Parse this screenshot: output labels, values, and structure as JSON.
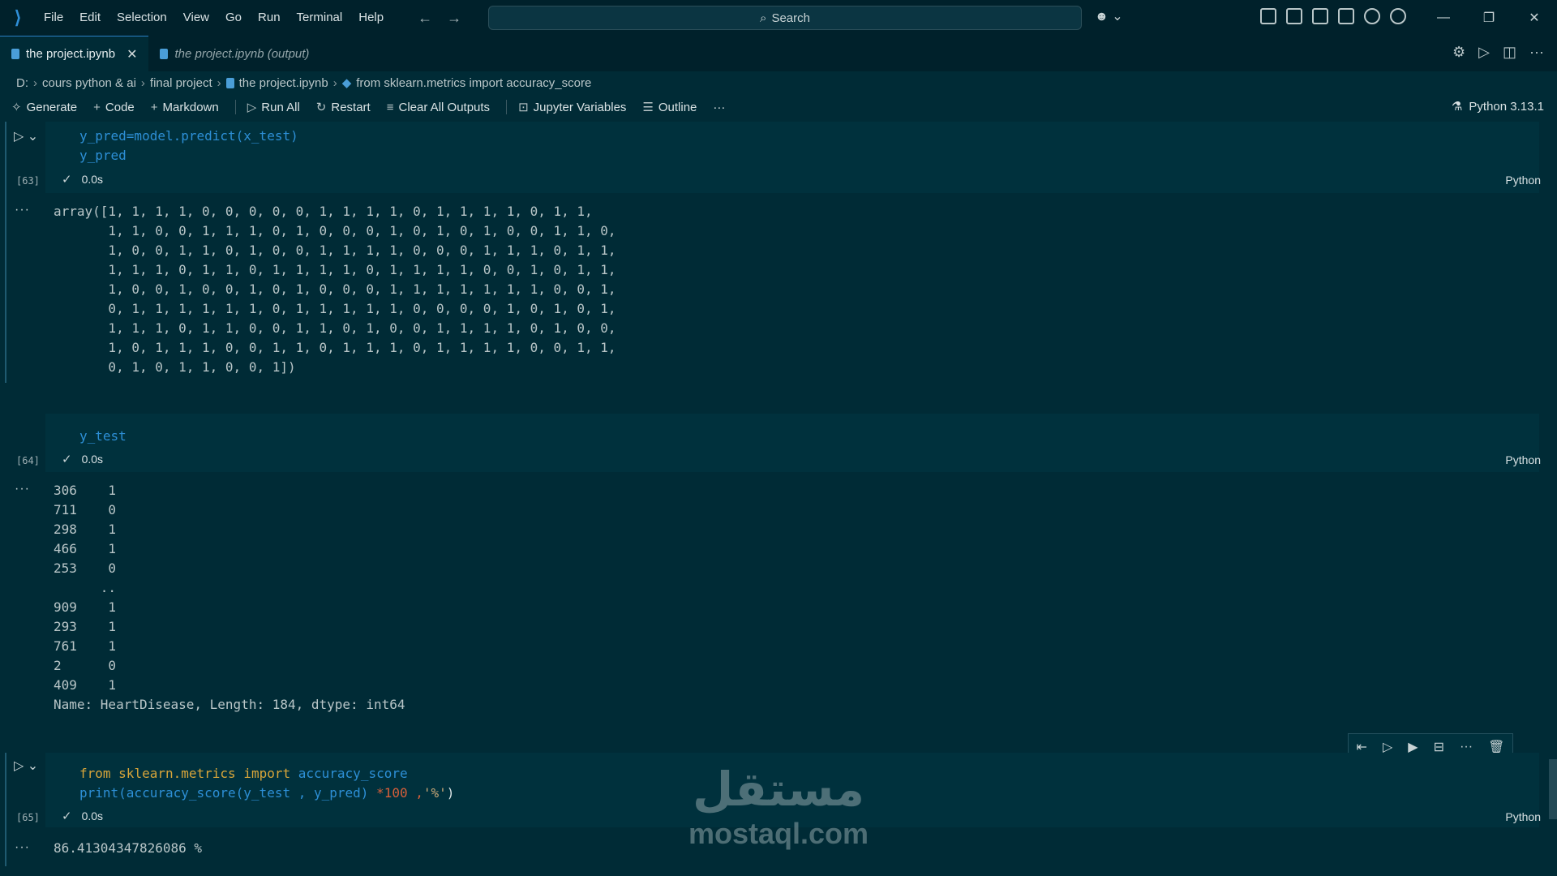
{
  "menu": [
    "File",
    "Edit",
    "Selection",
    "View",
    "Go",
    "Run",
    "Terminal",
    "Help"
  ],
  "search": {
    "label": "Search"
  },
  "tabs": [
    {
      "label": "the project.ipynb",
      "active": true
    },
    {
      "label": "the project.ipynb (output)",
      "active": false
    }
  ],
  "breadcrumb": [
    "D:",
    "cours python & ai",
    "final project",
    "the project.ipynb",
    "from sklearn.metrics import accuracy_score"
  ],
  "toolbar": {
    "generate": "Generate",
    "code": "Code",
    "markdown": "Markdown",
    "run_all": "Run All",
    "restart": "Restart",
    "clear": "Clear All Outputs",
    "variables": "Jupyter Variables",
    "outline": "Outline",
    "more": "···",
    "kernel": "Python 3.13.1"
  },
  "cells": [
    {
      "exec": "[63]",
      "time": "0.0s",
      "lang": "Python",
      "code_line1": "y_pred=model.predict(x_test)",
      "code_line2": "y_pred",
      "output": "array([1, 1, 1, 1, 0, 0, 0, 0, 0, 1, 1, 1, 1, 0, 1, 1, 1, 1, 0, 1, 1,\n       1, 1, 0, 0, 1, 1, 1, 0, 1, 0, 0, 0, 1, 0, 1, 0, 1, 0, 0, 1, 1, 0,\n       1, 0, 0, 1, 1, 0, 1, 0, 0, 1, 1, 1, 1, 0, 0, 0, 1, 1, 1, 0, 1, 1,\n       1, 1, 1, 0, 1, 1, 0, 1, 1, 1, 1, 0, 1, 1, 1, 1, 0, 0, 1, 0, 1, 1,\n       1, 0, 0, 1, 0, 0, 1, 0, 1, 0, 0, 0, 1, 1, 1, 1, 1, 1, 1, 0, 0, 1,\n       0, 1, 1, 1, 1, 1, 1, 0, 1, 1, 1, 1, 1, 0, 0, 0, 0, 1, 0, 1, 0, 1,\n       1, 1, 1, 0, 1, 1, 0, 0, 1, 1, 0, 1, 0, 0, 1, 1, 1, 1, 0, 1, 0, 0,\n       1, 0, 1, 1, 1, 0, 0, 1, 1, 0, 1, 1, 1, 0, 1, 1, 1, 1, 0, 0, 1, 1,\n       0, 1, 0, 1, 1, 0, 0, 1])"
    },
    {
      "exec": "[64]",
      "time": "0.0s",
      "lang": "Python",
      "code_line1": "y_test",
      "output": "306    1\n711    0\n298    1\n466    1\n253    0\n      ..\n909    1\n293    1\n761    1\n2      0\n409    1\nName: HeartDisease, Length: 184, dtype: int64"
    },
    {
      "exec": "[65]",
      "time": "0.0s",
      "lang": "Python",
      "code_from": "from",
      "code_module": "sklearn.metrics",
      "code_import": "import",
      "code_name": "accuracy_score",
      "code_print": "print(accuracy_score(y_test , y_pred)",
      "code_mul": " *100 ,",
      "code_str": "'%'",
      "code_close": ")",
      "output": "86.41304347826086 %"
    }
  ],
  "watermark": {
    "arabic": "مستقل",
    "latin": "mostaql.com"
  }
}
